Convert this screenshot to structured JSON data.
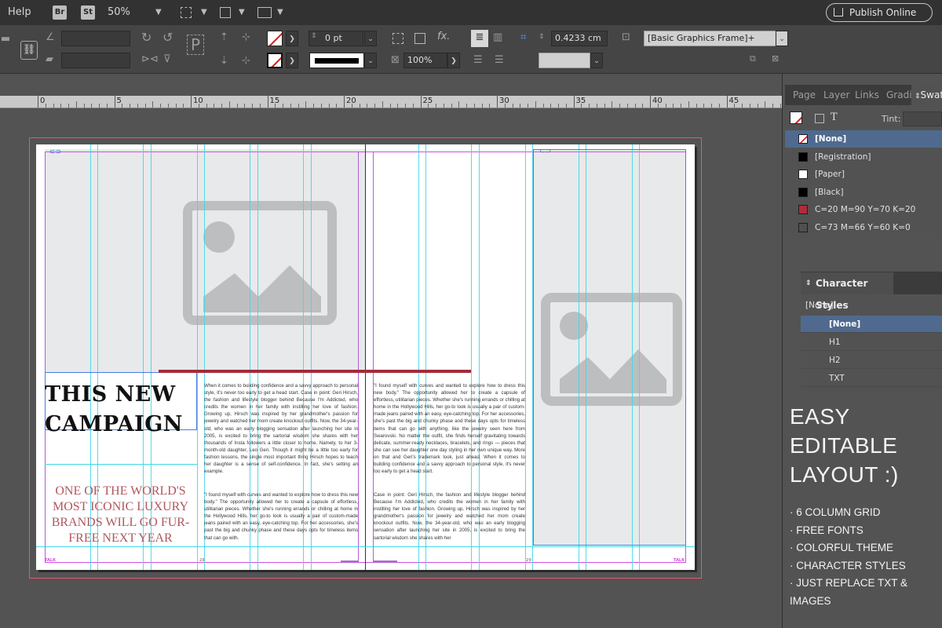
{
  "menubar": {
    "help": "Help",
    "bridge_badge": "Br",
    "stock_badge": "St",
    "zoom": "50%",
    "publish_online": "Publish Online"
  },
  "controlbar": {
    "stroke_weight": "0 pt",
    "opacity": "100%",
    "gap_value": "0.4233 cm",
    "object_style": "[Basic Graphics Frame]+"
  },
  "ruler": {
    "numbers": [
      "0",
      "5",
      "10",
      "15",
      "20",
      "25",
      "30",
      "35",
      "40",
      "45"
    ]
  },
  "document": {
    "headline_lines": [
      "THIS NEW",
      "CAMPAIGN"
    ],
    "subhead": "ONE OF THE WORLD'S MOST ICONIC LUXURY BRANDS WILL GO FUR-FREE NEXT YEAR",
    "column1": "When it comes to building confidence and a savvy approach to personal style, it's never too early to get a head start. Case in point: Geri Hirsch, the fashion and lifestyle blogger behind Because I'm Addicted, who credits the women in her family with instilling her love of fashion. Growing up, Hirsch was inspired by her grandmother's passion for jewelry and watched her mom create knockout outfits. Now, the 34-year-old, who was an early blogging sensation after launching her site in 2005, is excited to bring the sartorial wisdom she shares with her thousands of Insta followers a little closer to home. Namely, to her 3-month-old daughter, Leo Geri. Though it might be a little too early for fashion lessons, the single most important thing Hirsch hopes to teach her daughter is a sense of self-confidence. In fact, she's setting an example.",
    "column1b": "\"I found myself with curves and wanted to explore how to dress this new body.\" The opportunity allowed her to create a capsule of effortless, utilitarian pieces. Whether she's running errands or chilling at home in the Hollywood Hills, her go-to look is usually a pair of custom-made jeans paired with an easy, eye-catching top. For her accessories, she's past the big and chunky phase and these days opts for timeless items that can go with.",
    "column2": "\"I found myself with curves and wanted to explore how to dress this new body.\" The opportunity allowed her to create a capsule of effortless, utilitarian pieces. Whether she's running errands or chilling at home in the Hollywood Hills, her go-to look is usually a pair of custom-made jeans paired with an easy, eye-catching top. For her accessories, she's past the big and chunky phase and these days opts for timeless items that can go with anything, like the jewelry seen here from Swarovski. No matter the outfit, she finds herself gravitating towards delicate, summer-ready necklaces, bracelets, and rings — pieces that she can see her daughter one day styling in her own unique way. More on that and Geri's trademark look, just ahead. When it comes to building confidence and a savvy approach to personal style, it's never too early to get a head start.",
    "column2b": "Case in point: Geri Hirsch, the fashion and lifestyle blogger behind Because I'm Addicted, who credits the women in her family with instilling her love of fashion. Growing up, Hirsch was inspired by her grandmother's passion for jewelry and watched her mom create knockout outfits. Now, the 34-year-old, who was an early blogging sensation after launching her site in 2005, is excited to bring the sartorial wisdom she shares with her",
    "footer_left": "TALK",
    "footer_right": "TALK",
    "folio_left": "28",
    "folio_right": "29"
  },
  "panels": {
    "tabs": [
      "Page",
      "Layer",
      "Links",
      "Gradi",
      "Swat"
    ],
    "tint_label": "Tint:",
    "swatches": [
      {
        "name": "[None]",
        "color": "#ffffff",
        "selected": true
      },
      {
        "name": "[Registration]",
        "color": "#000000",
        "selected": false
      },
      {
        "name": "[Paper]",
        "color": "#ffffff",
        "selected": false
      },
      {
        "name": "[Black]",
        "color": "#000000",
        "selected": false
      },
      {
        "name": "C=20 M=90 Y=70 K=20",
        "color": "#b22a3a",
        "selected": false
      },
      {
        "name": "C=73 M=66 Y=60 K=0",
        "color": "#505050",
        "selected": false
      }
    ],
    "character_styles": {
      "tab": "Character Styles",
      "current": "[None]",
      "items": [
        "[None]",
        "H1",
        "H2",
        "TXT"
      ]
    }
  },
  "promo": {
    "title_lines": [
      "EASY",
      "EDITABLE",
      "LAYOUT :)"
    ],
    "features": [
      "· 6 COLUMN GRID",
      "· FREE FONTS",
      "· COLORFUL THEME",
      "· CHARACTER STYLES",
      "· JUST REPLACE TXT & IMAGES"
    ]
  },
  "colors": {
    "accent_red": "#a32b3a",
    "guide_cyan": "#41d6ea",
    "margin_magenta": "#d24de1",
    "selection_blue": "#4f6a8e"
  }
}
